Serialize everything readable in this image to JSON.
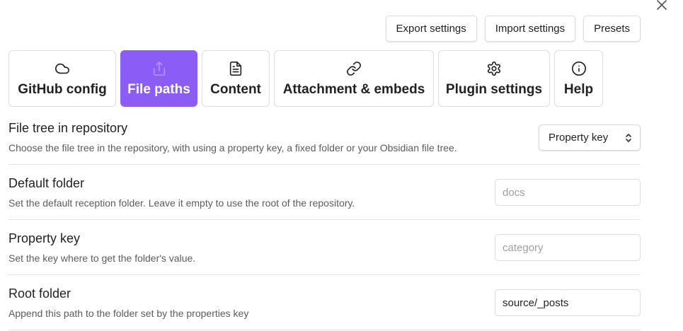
{
  "top_buttons": {
    "export": "Export settings",
    "import": "Import settings",
    "presets": "Presets"
  },
  "tabs": [
    {
      "label": "GitHub config",
      "icon": "cloud-icon",
      "active": false
    },
    {
      "label": "File paths",
      "icon": "upload-icon",
      "active": true
    },
    {
      "label": "Content",
      "icon": "document-icon",
      "active": false
    },
    {
      "label": "Attachment & embeds",
      "icon": "link-icon",
      "active": false
    },
    {
      "label": "Plugin settings",
      "icon": "gear-icon",
      "active": false
    },
    {
      "label": "Help",
      "icon": "info-icon",
      "active": false
    }
  ],
  "colors": {
    "accent": "#8b5cf6"
  },
  "settings": {
    "file_tree": {
      "name": "File tree in repository",
      "desc": "Choose the file tree in the repository, with using a property key, a fixed folder or your Obsidian file tree.",
      "selected": "Property key"
    },
    "default_folder": {
      "name": "Default folder",
      "desc": "Set the default reception folder. Leave it empty to use the root of the repository.",
      "value": "",
      "placeholder": "docs"
    },
    "property_key": {
      "name": "Property key",
      "desc": "Set the key where to get the folder's value.",
      "value": "",
      "placeholder": "category"
    },
    "root_folder": {
      "name": "Root folder",
      "desc": "Append this path to the folder set by the properties key",
      "value": "source/_posts",
      "placeholder": ""
    }
  }
}
